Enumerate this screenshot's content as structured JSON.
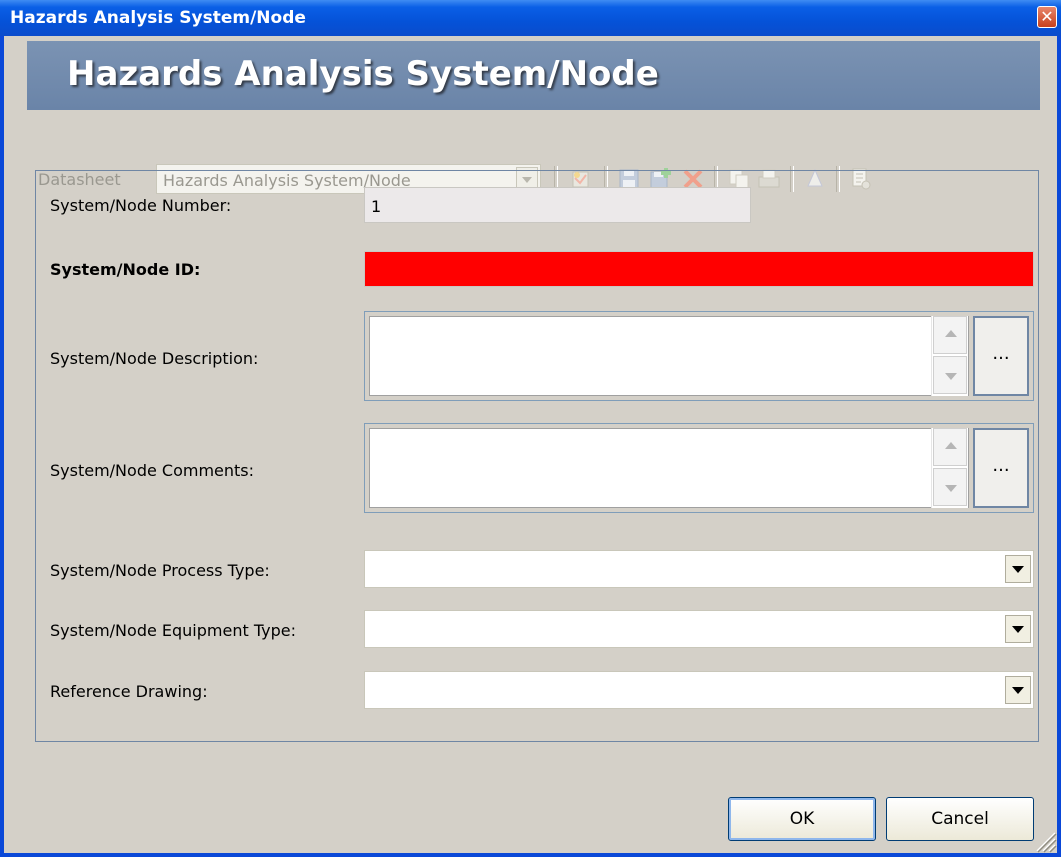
{
  "window": {
    "title": "Hazards Analysis System/Node",
    "close_label": "✕"
  },
  "header": {
    "title": "Hazards Analysis System/Node"
  },
  "toolbar": {
    "datasheet_label": "Datasheet",
    "datasheet_value": "Hazards Analysis System/Node"
  },
  "fields": {
    "number_label": "System/Node Number:",
    "number_value": "1",
    "id_label": "System/Node ID:",
    "description_label": "System/Node Description:",
    "comments_label": "System/Node Comments:",
    "process_type_label": "System/Node Process Type:",
    "equipment_type_label": "System/Node Equipment Type:",
    "reference_drawing_label": "Reference Drawing:",
    "ellipsis_label": "..."
  },
  "footer": {
    "ok_label": "OK",
    "cancel_label": "Cancel"
  },
  "colors": {
    "title_bar": "#0a5fe6",
    "banner": "#7189ac",
    "required_field": "#ff0000",
    "dialog_bg": "#d4d0c8"
  }
}
